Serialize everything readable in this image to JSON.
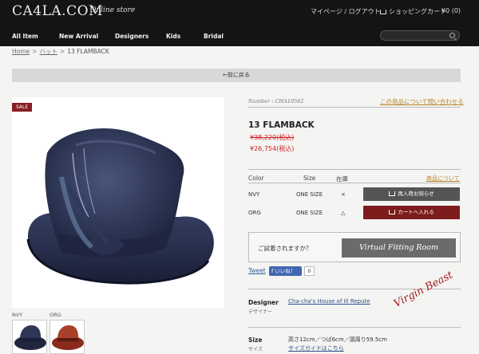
{
  "header": {
    "logo_text": "CA4LA.COM",
    "logo_sub": "Online store",
    "mypage_label": "マイページ / ログアウト",
    "cart_label": "ショッピングカート",
    "cart_count": "¥0 (0)",
    "nav": [
      "All Item",
      "New Arrival",
      "Designers",
      "Kids",
      "Bridal"
    ]
  },
  "breadcrumb": {
    "home": "Home",
    "category": "ハット",
    "current": "13 FLAMBACK",
    "separator": ">"
  },
  "back_label": "←前に戻る",
  "product": {
    "sale_badge": "SALE",
    "number": "Number : CHA10562",
    "inquiry_link": "この商品について問い合わせる",
    "name": "13 FLAMBACK",
    "old_price": "¥38,220(税込)",
    "new_price": "¥26,754(税込)",
    "variant_headers": {
      "color": "Color",
      "size": "Size",
      "stock": "在庫",
      "about_link": "商品について"
    },
    "variants": [
      {
        "color": "NVY",
        "size": "ONE SIZE",
        "stock": "×",
        "button": "再入荷お知らせ"
      },
      {
        "color": "ORG",
        "size": "ONE SIZE",
        "stock": "△",
        "button": "カートへ入れる"
      }
    ],
    "fitting_question": "ご試着されますか？",
    "fitting_button": "Virtual Fitting Room",
    "tweet": "Tweet",
    "fb_like": "いいね！",
    "fb_count": "0",
    "designer_label": "Designer",
    "designer_sub": "デザイナー",
    "designer_value": "Cha-cha's House of Ill Repute",
    "size_label": "Size",
    "size_sub": "サイズ",
    "size_value": "高さ12cm／つば6cm／頭周り59.5cm",
    "size_guide": "サイズガイドはこちら",
    "signature": "Virgin Beast",
    "thumbs": [
      "NVY",
      "ORG"
    ]
  },
  "colors": {
    "header_bg": "#141414",
    "sale": "#8a1d24",
    "price": "#cc2222",
    "link": "#b8862a",
    "cart_btn": "#7c1c1c"
  },
  "icons": [
    "cart-icon",
    "search-icon",
    "facebook-icon"
  ]
}
